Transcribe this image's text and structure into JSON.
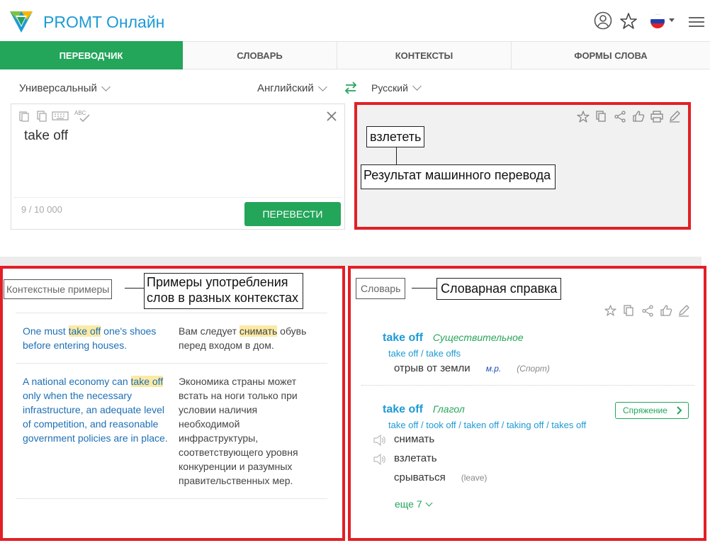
{
  "header": {
    "brand": "PROMT Онлайн",
    "icons": [
      "logo-icon",
      "user-icon",
      "star-icon",
      "flag-ru-icon",
      "menu-icon"
    ],
    "accent_color": "#1d9ad6"
  },
  "tabs": [
    {
      "label": "ПЕРЕВОДЧИК",
      "active": true
    },
    {
      "label": "СЛОВАРЬ",
      "active": false
    },
    {
      "label": "КОНТЕКСТЫ",
      "active": false
    },
    {
      "label": "ФОРМЫ СЛОВА",
      "active": false
    }
  ],
  "translator": {
    "topic": "Универсальный",
    "source_lang": "Английский",
    "target_lang": "Русский",
    "source_text": "take off",
    "counter": "9 / 10 000",
    "translate_button": "ПЕРЕВЕСТИ",
    "result_text": "взлететь",
    "result_annotation": "Результат машинного перевода"
  },
  "contexts": {
    "label": "Контекстные примеры",
    "annotation_line1": "Примеры употребления",
    "annotation_line2": "слов в разных контекстах",
    "examples": [
      {
        "en_before": "One must ",
        "en_hl": "take off",
        "en_after": " one's shoes before entering houses.",
        "ru_before": "Вам следует ",
        "ru_hl": "снимать",
        "ru_after": " обувь перед входом в дом."
      },
      {
        "en_before": "A national economy can ",
        "en_hl": "take off",
        "en_after": " only when the necessary infrastructure, an adequate level of competition, and reasonable government policies are in place.",
        "ru_before": "Экономика страны может встать на ноги только при условии наличия необходимой инфраструктуры, соответствующего уровня конкуренции и разумных правительственных мер.",
        "ru_hl": "",
        "ru_after": ""
      }
    ]
  },
  "dictionary": {
    "label": "Словарь",
    "annotation": "Словарная справка",
    "entries": [
      {
        "headword": "take off",
        "pos": "Существительное",
        "forms": "take off / take offs",
        "translations": [
          {
            "text": "отрыв от земли",
            "gram": "м.р.",
            "domain": "(Спорт)"
          }
        ]
      },
      {
        "headword": "take off",
        "pos": "Глагол",
        "forms": "take off / took off / taken off / taking off / takes off",
        "conjugation_button": "Спряжение",
        "translations": [
          {
            "text": "снимать",
            "note": ""
          },
          {
            "text": "взлетать",
            "note": ""
          },
          {
            "text": "срываться",
            "note": "(leave)"
          }
        ],
        "more": "еще 7"
      }
    ]
  },
  "colors": {
    "green": "#23a55a",
    "highlight_red": "#e21f26",
    "link_blue": "#1d6fb5"
  }
}
